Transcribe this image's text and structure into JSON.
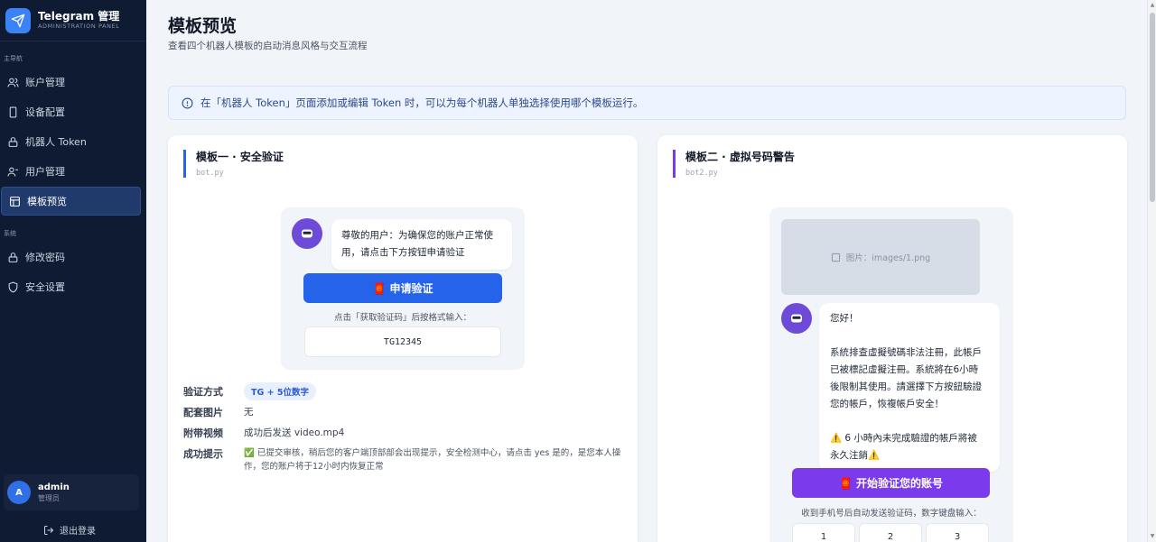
{
  "brand": {
    "title": "Telegram 管理",
    "subtitle": "ADMINISTRATION PANEL"
  },
  "sidebar": {
    "section_main": "主导航",
    "section_system": "系统",
    "items": [
      {
        "label": "账户管理",
        "icon": "users-icon"
      },
      {
        "label": "设备配置",
        "icon": "phone-icon"
      },
      {
        "label": "机器人 Token",
        "icon": "lock-icon"
      },
      {
        "label": "用户管理",
        "icon": "user-icon"
      },
      {
        "label": "模板预览",
        "icon": "layout-icon",
        "active": true
      }
    ],
    "system_items": [
      {
        "label": "修改密码",
        "icon": "lock-icon"
      },
      {
        "label": "安全设置",
        "icon": "shield-icon"
      }
    ]
  },
  "user": {
    "avatar_letter": "A",
    "name": "admin",
    "role": "管理员"
  },
  "logout_label": "退出登录",
  "page": {
    "title": "模板预览",
    "subtitle": "查看四个机器人模板的启动消息风格与交互流程"
  },
  "notice": "在「机器人 Token」页面添加或编辑 Token 时，可以为每个机器人单独选择使用哪个模板运行。",
  "template1": {
    "title": "模板一 · 安全验证",
    "file": "bot.py",
    "message": "尊敬的用户：为确保您的账户正常使\n用，请点击下方按钮申请验证",
    "button": "🧧 申请验证",
    "hint": "点击「获取验证码」后按格式输入：",
    "code_example": "TG12345",
    "meta": {
      "verify_label": "验证方式",
      "verify_value": "TG + 5位数字",
      "image_label": "配套图片",
      "image_value": "无",
      "video_label": "附带视频",
      "video_value": "成功后发送 video.mp4",
      "success_label": "成功提示",
      "success_value": "✅ 已提交审核，稍后您的客户端顶部部会出现提示，安全检测中心，请点击 yes 是的，是您本人操作，您的账户将于12小时内恢复正常"
    }
  },
  "template2": {
    "title": "模板二 · 虚拟号码警告",
    "file": "bot2.py",
    "image_label": "图片：images/1.png",
    "message": "您好！\n\n系統排查虛擬號碼非法注冊，此帳戶\n已被標記虛擬注冊。系統將在6小時\n後限制其使用。請選擇下方按鈕驗證\n您的帳戶，恢複帳戶安全！\n\n⚠️ 6 小時內未完成驗證的帳戶將被\n永久注銷⚠️",
    "button": "🧧 开始验证您的账号",
    "hint": "收到手机号后自动发送验证码，数字键盘输入：",
    "keys": [
      "1",
      "2",
      "3"
    ]
  },
  "colors": {
    "accent": "#2563eb",
    "purple": "#7c3aed",
    "sidebar": "#0f1b33"
  }
}
